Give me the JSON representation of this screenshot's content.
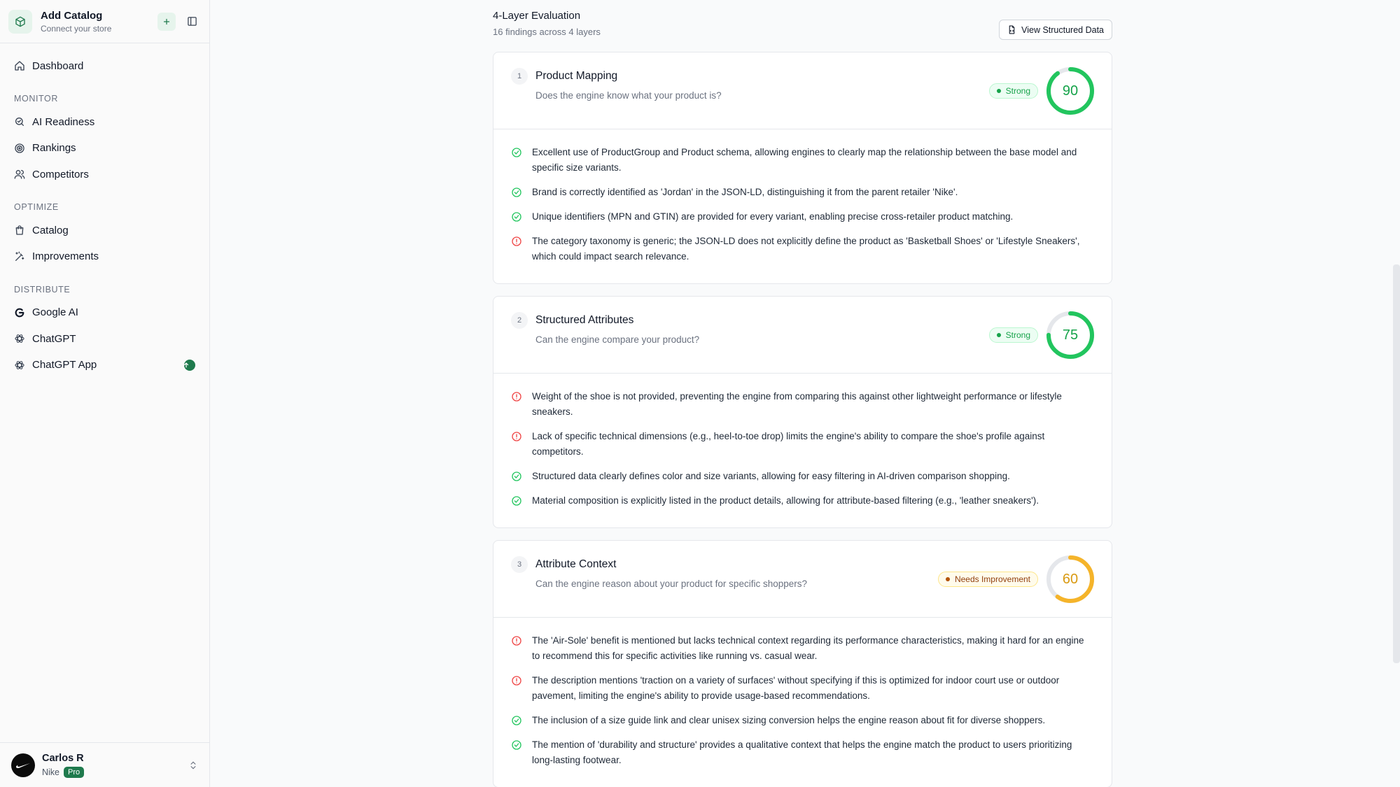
{
  "sidebar": {
    "title": "Add Catalog",
    "subtitle": "Connect your store",
    "nav": {
      "dashboard": "Dashboard",
      "monitor_label": "MONITOR",
      "ai_readiness": "AI Readiness",
      "rankings": "Rankings",
      "competitors": "Competitors",
      "optimize_label": "OPTIMIZE",
      "catalog": "Catalog",
      "improvements": "Improvements",
      "distribute_label": "DISTRIBUTE",
      "google_ai": "Google AI",
      "chatgpt": "ChatGPT",
      "chatgpt_app": "ChatGPT App"
    },
    "user": {
      "name": "Carlos R",
      "org": "Nike",
      "plan": "Pro"
    }
  },
  "evaluation": {
    "title": "4-Layer Evaluation",
    "subtitle": "16 findings across 4 layers",
    "view_button": "View Structured Data"
  },
  "colors": {
    "positive": "#22c55e",
    "negative": "#ef4444",
    "warning": "#f5b42a",
    "brand": "#1f7a4d"
  },
  "layers": [
    {
      "number": "1",
      "title": "Product Mapping",
      "question": "Does the engine know what your product is?",
      "status": "Strong",
      "score": "90",
      "findings": [
        {
          "type": "positive",
          "text": "Excellent use of ProductGroup and Product schema, allowing engines to clearly map the relationship between the base model and specific size variants."
        },
        {
          "type": "positive",
          "text": "Brand is correctly identified as 'Jordan' in the JSON-LD, distinguishing it from the parent retailer 'Nike'."
        },
        {
          "type": "positive",
          "text": "Unique identifiers (MPN and GTIN) are provided for every variant, enabling precise cross-retailer product matching."
        },
        {
          "type": "negative",
          "text": "The category taxonomy is generic; the JSON-LD does not explicitly define the product as 'Basketball Shoes' or 'Lifestyle Sneakers', which could impact search relevance."
        }
      ]
    },
    {
      "number": "2",
      "title": "Structured Attributes",
      "question": "Can the engine compare your product?",
      "status": "Strong",
      "score": "75",
      "findings": [
        {
          "type": "negative",
          "text": "Weight of the shoe is not provided, preventing the engine from comparing this against other lightweight performance or lifestyle sneakers."
        },
        {
          "type": "negative",
          "text": "Lack of specific technical dimensions (e.g., heel-to-toe drop) limits the engine's ability to compare the shoe's profile against competitors."
        },
        {
          "type": "positive",
          "text": "Structured data clearly defines color and size variants, allowing for easy filtering in AI-driven comparison shopping."
        },
        {
          "type": "positive",
          "text": "Material composition is explicitly listed in the product details, allowing for attribute-based filtering (e.g., 'leather sneakers')."
        }
      ]
    },
    {
      "number": "3",
      "title": "Attribute Context",
      "question": "Can the engine reason about your product for specific shoppers?",
      "status": "Needs Improvement",
      "score": "60",
      "findings": [
        {
          "type": "negative",
          "text": "The 'Air-Sole' benefit is mentioned but lacks technical context regarding its performance characteristics, making it hard for an engine to recommend this for specific activities like running vs. casual wear."
        },
        {
          "type": "negative",
          "text": "The description mentions 'traction on a variety of surfaces' without specifying if this is optimized for indoor court use or outdoor pavement, limiting the engine's ability to provide usage-based recommendations."
        },
        {
          "type": "positive",
          "text": "The inclusion of a size guide link and clear unisex sizing conversion helps the engine reason about fit for diverse shoppers."
        },
        {
          "type": "positive",
          "text": "The mention of 'durability and structure' provides a qualitative context that helps the engine match the product to users prioritizing long-lasting footwear."
        }
      ]
    }
  ]
}
